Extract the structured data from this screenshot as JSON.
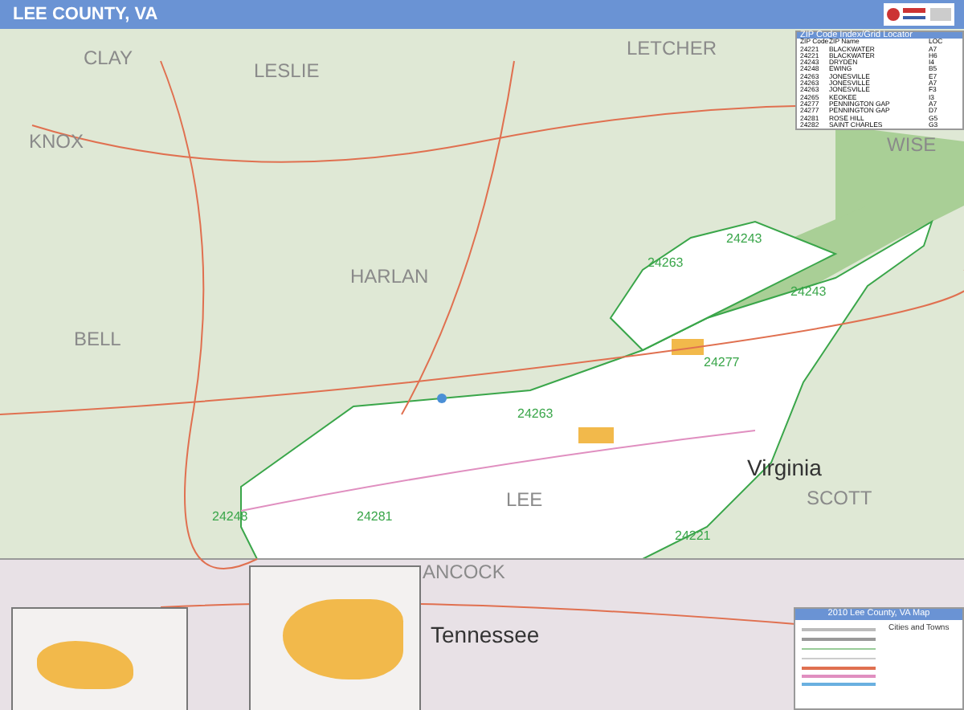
{
  "title": "LEE COUNTY, VA",
  "map_labels": [
    {
      "text": "CLAY",
      "kind": "county"
    },
    {
      "text": "LESLIE",
      "kind": "county"
    },
    {
      "text": "LETCHER",
      "kind": "county"
    },
    {
      "text": "KNOX",
      "kind": "county"
    },
    {
      "text": "WISE",
      "kind": "county"
    },
    {
      "text": "HARLAN",
      "kind": "county"
    },
    {
      "text": "BELL",
      "kind": "county"
    },
    {
      "text": "LEE",
      "kind": "county"
    },
    {
      "text": "SCOTT",
      "kind": "county"
    },
    {
      "text": "ANCOCK",
      "kind": "county"
    },
    {
      "text": "Virginia",
      "kind": "state"
    },
    {
      "text": "Tennessee",
      "kind": "state"
    },
    {
      "text": "24263",
      "kind": "zip"
    },
    {
      "text": "24243",
      "kind": "zip"
    },
    {
      "text": "24277",
      "kind": "zip"
    },
    {
      "text": "24248",
      "kind": "zip"
    },
    {
      "text": "24281",
      "kind": "zip"
    },
    {
      "text": "24221",
      "kind": "zip"
    },
    {
      "text": "24263",
      "kind": "zip"
    },
    {
      "text": "24243",
      "kind": "zip"
    }
  ],
  "zip_index": {
    "title": "ZIP Code Index/Grid Locator",
    "columns": [
      "ZIP Code",
      "ZIP Name",
      "LOC"
    ],
    "rows": [
      [
        "24221",
        "BLACKWATER",
        "A7"
      ],
      [
        "24221",
        "BLACKWATER",
        "H6"
      ],
      [
        "24243",
        "DRYDEN",
        "I4"
      ],
      [
        "24248",
        "EWING",
        "B5"
      ],
      [
        "24263",
        "JONESVILLE",
        "E7"
      ],
      [
        "24263",
        "JONESVILLE",
        "A7"
      ],
      [
        "24263",
        "JONESVILLE",
        "F3"
      ],
      [
        "24265",
        "KEOKEE",
        "I3"
      ],
      [
        "24277",
        "PENNINGTON GAP",
        "A7"
      ],
      [
        "24277",
        "PENNINGTON GAP",
        "D7"
      ],
      [
        "24281",
        "ROSE HILL",
        "G5"
      ],
      [
        "24282",
        "SAINT CHARLES",
        "G3"
      ]
    ]
  },
  "legend": {
    "title": "2010 Lee County, VA Map",
    "subtitle": "Cities and Towns"
  }
}
